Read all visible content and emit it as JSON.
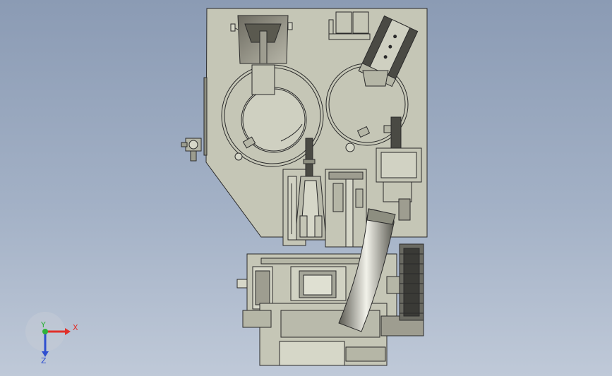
{
  "viewport": {
    "background_top": "#8b9bb4",
    "background_bottom": "#bfc9d8"
  },
  "model": {
    "panel_color": "#c5c6b6",
    "line_color": "#2a2a2a",
    "dark_part_color": "#4a4a44"
  },
  "triad": {
    "x_label": "X",
    "y_label": "Y",
    "z_label": "Z",
    "x_color": "#e0302a",
    "y_color": "#2fb23a",
    "z_color": "#2f4fd0"
  }
}
